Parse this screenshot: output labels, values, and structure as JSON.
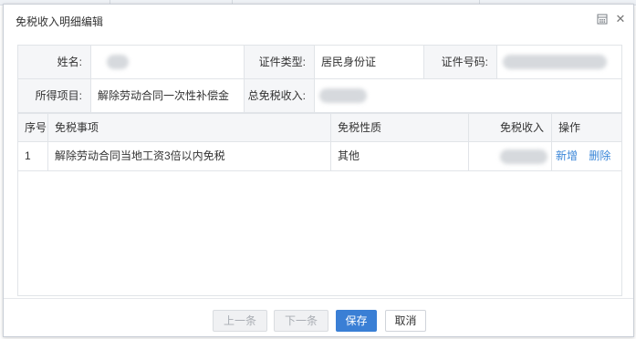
{
  "dialog": {
    "title": "免税收入明细编辑",
    "icons": {
      "calculator": "calculator-icon",
      "close": "close-icon",
      "close_glyph": "✕"
    }
  },
  "form": {
    "name_label": "姓名:",
    "name_value": "",
    "id_type_label": "证件类型:",
    "id_type_value": "居民身份证",
    "id_number_label": "证件号码:",
    "id_number_value": "",
    "income_item_label": "所得项目:",
    "income_item_value": "解除劳动合同一次性补偿金",
    "total_exempt_label": "总免税收入:",
    "total_exempt_value": ""
  },
  "table": {
    "headers": [
      "序号",
      "免税事项",
      "免税性质",
      "免税收入",
      "操作"
    ],
    "rows": [
      {
        "index": "1",
        "item": "解除劳动合同当地工资3倍以内免税",
        "nature": "其他",
        "amount": "",
        "actions": [
          "新增",
          "删除"
        ]
      }
    ]
  },
  "footer": {
    "prev": "上一条",
    "next": "下一条",
    "save": "保存",
    "cancel": "取消"
  },
  "colors": {
    "primary": "#3a7fd5",
    "link": "#3a86d8",
    "label_bg": "#f5f6f8",
    "border": "#e1e4e8"
  }
}
